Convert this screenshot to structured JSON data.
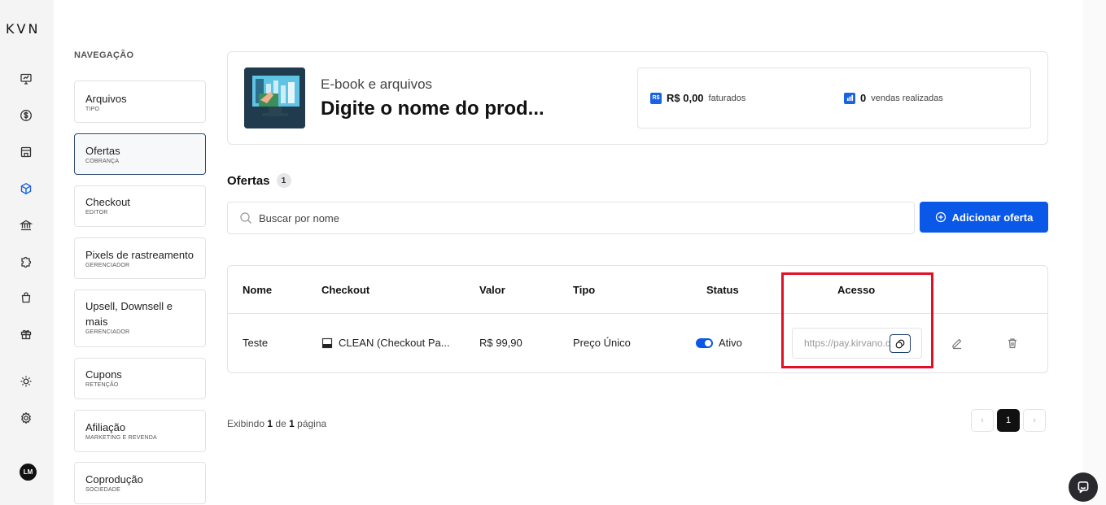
{
  "brand": {
    "logo": "KVN"
  },
  "rail": {
    "icons": [
      "monitor-icon",
      "dollar-icon",
      "store-icon",
      "box-icon",
      "bank-icon",
      "puzzle-icon",
      "bag-icon",
      "gift-icon",
      "sun-icon",
      "gear-icon"
    ],
    "active_icon": "box-icon",
    "user_initials": "LM"
  },
  "nav": {
    "title": "NAVEGAÇÃO",
    "items": [
      {
        "label": "Arquivos",
        "sub": "TIPO"
      },
      {
        "label": "Ofertas",
        "sub": "COBRANÇA",
        "active": true
      },
      {
        "label": "Checkout",
        "sub": "EDITOR"
      },
      {
        "label": "Pixels de rastreamento",
        "sub": "GERENCIADOR"
      },
      {
        "label": "Upsell, Downsell e mais",
        "sub": "GERENCIADOR"
      },
      {
        "label": "Cupons",
        "sub": "RETENÇÃO"
      },
      {
        "label": "Afiliação",
        "sub": "MARKETING E REVENDA"
      },
      {
        "label": "Coprodução",
        "sub": "SOCIEDADE"
      }
    ]
  },
  "product": {
    "type": "E-book e arquivos",
    "name": "Digite o nome do prod...",
    "revenue_icon": "R$",
    "revenue_value": "R$ 0,00",
    "revenue_label": "faturados",
    "sales_value": "0",
    "sales_label": "vendas realizadas"
  },
  "offers": {
    "title": "Ofertas",
    "count": "1",
    "search_placeholder": "Buscar por nome",
    "add_button": "Adicionar oferta",
    "columns": {
      "nome": "Nome",
      "checkout": "Checkout",
      "valor": "Valor",
      "tipo": "Tipo",
      "status": "Status",
      "acesso": "Acesso"
    },
    "rows": [
      {
        "nome": "Teste",
        "checkout": "CLEAN (Checkout Pa...",
        "valor": "R$ 99,90",
        "tipo": "Preço Único",
        "status": "Ativo",
        "status_on": true,
        "acesso": "https://pay.kirvano.com"
      }
    ]
  },
  "pagination": {
    "prefix": "Exibindo",
    "current": "1",
    "mid": "de",
    "total": "1",
    "suffix": "página",
    "prev": "‹",
    "next": "›",
    "page_button": "1"
  },
  "colors": {
    "primary": "#0a58e8",
    "highlight": "#e0102a"
  }
}
